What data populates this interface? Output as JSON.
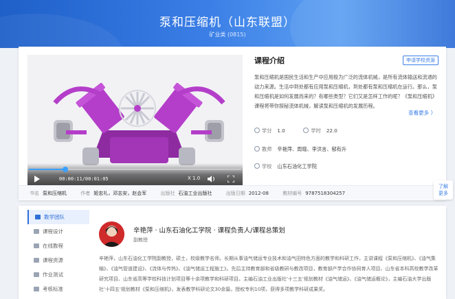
{
  "banner": {
    "title": "泵和压缩机（山东联盟）",
    "subtitle": "矿业类 (0815)"
  },
  "video": {
    "time_text": "00:00:11/00:01:05",
    "speed_label": "X 1.0",
    "progress_fraction": 0.17
  },
  "intro": {
    "title": "课程介绍",
    "apply_label": "申请学校资源",
    "text": "泵和压缩机是国民生活和生产中应用极为广泛的流体机械，是所有流体输送和流通的动力来源。生活中到处都有应用泵和压缩机，到处都有泵和压缩机在运行。那么，泵和压缩机是如何发展而来的？有哪些类型？它们又是怎样工作的呢？《泵和压缩机》课程将带你探秘流体机械，解读泵和压缩机的发展历程。",
    "more_label": "查看更多 〉"
  },
  "meta": {
    "credit_label": "学分",
    "credit_value": "1.0",
    "hours_label": "学时",
    "hours_value": "22.0",
    "teacher_label": "教师",
    "teachers": "辛艳萍、周晓、李洪言、郁有升",
    "school_label": "学校",
    "school": "山东石油化工学院"
  },
  "book": {
    "title_label": "书名",
    "title_value": "泵和压缩机",
    "author_label": "作者",
    "author_value": "姬忠礼，邓志安，赵会军",
    "publisher_label": "出版社",
    "publisher_value": "石油工业出版社",
    "date_label": "出版日期",
    "date_value": "2012-08",
    "isbn_label": "教材编号",
    "isbn_value": "9787518304257"
  },
  "side_tab": {
    "line1": "了解",
    "line2": "更多"
  },
  "menu": [
    {
      "label": "教学团队",
      "active": true
    },
    {
      "label": "课程设计",
      "active": false
    },
    {
      "label": "在线教程",
      "active": false
    },
    {
      "label": "课程资源",
      "active": false
    },
    {
      "label": "作业测试",
      "active": false
    },
    {
      "label": "考核标准",
      "active": false
    }
  ],
  "teacher": {
    "name_line": "辛艳萍 · 山东石油化工学院 · 课程负责人/课程总策划",
    "title": "副教授",
    "bio": "辛艳萍，山东石油化工学院副教授，硕士，校级教学名师。长期从事油气储运专业技术和油气田特色方面的教学和科研工作，主讲课程《泵和压缩机》、《油气集输》、《油气管道建设》、《流体与传热》、《油气储运工程施工》。先后主持教育部和省级教研与教改项目，教育部产学合作协同育人项目、山东省本科高校教学改革研究项目、山东省高等学校科技计划项目等十余项教学和科研项目。主编石油工业出版社'十三五'规划教材《油气储运》、《油气储运概论》，主编石油大学出版社'十四五'规划教材《泵和压缩机》，发表教学科研论文30余篇，授权专利10项，获得多项教学科研成果奖。"
  },
  "colors": {
    "brand": "#2f6fd8",
    "accent": "#3aa0ff",
    "machine": "#b43ec9"
  }
}
